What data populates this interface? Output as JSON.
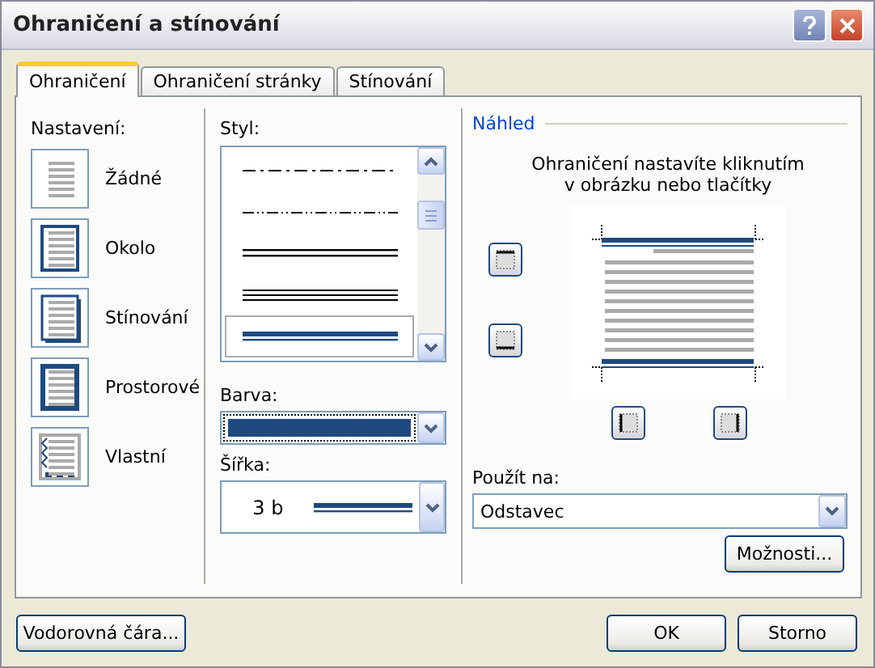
{
  "window": {
    "title": "Ohraničení a stínování"
  },
  "tabs": [
    {
      "label": "Ohraničení",
      "selected": true
    },
    {
      "label": "Ohraničení stránky",
      "selected": false
    },
    {
      "label": "Stínování",
      "selected": false
    }
  ],
  "settings": {
    "label": "Nastavení:",
    "items": [
      {
        "label": "Žádné",
        "kind": "none"
      },
      {
        "label": "Okolo",
        "kind": "box"
      },
      {
        "label": "Stínování",
        "kind": "shadow"
      },
      {
        "label": "Prostorové",
        "kind": "raised"
      },
      {
        "label": "Vlastní",
        "kind": "custom"
      }
    ]
  },
  "style": {
    "label": "Styl:",
    "items": [
      {
        "kind": "dashdot",
        "selected": false
      },
      {
        "kind": "dashdotdot",
        "selected": false
      },
      {
        "kind": "double",
        "selected": false
      },
      {
        "kind": "triple",
        "selected": false
      },
      {
        "kind": "thickthin",
        "selected": true
      }
    ]
  },
  "color": {
    "label": "Barva:",
    "color": "#1f4a7f"
  },
  "width": {
    "label": "Šířka:",
    "value": "3 b"
  },
  "preview": {
    "label": "Náhled",
    "hint": "Ohraničení nastavíte kliknutím\nv obrázku nebo tlačítky"
  },
  "apply": {
    "label": "Použít na:",
    "value": "Odstavec"
  },
  "buttons": {
    "options": "Možnosti...",
    "horizontal_line": "Vodorovná čára...",
    "ok": "OK",
    "cancel": "Storno"
  }
}
